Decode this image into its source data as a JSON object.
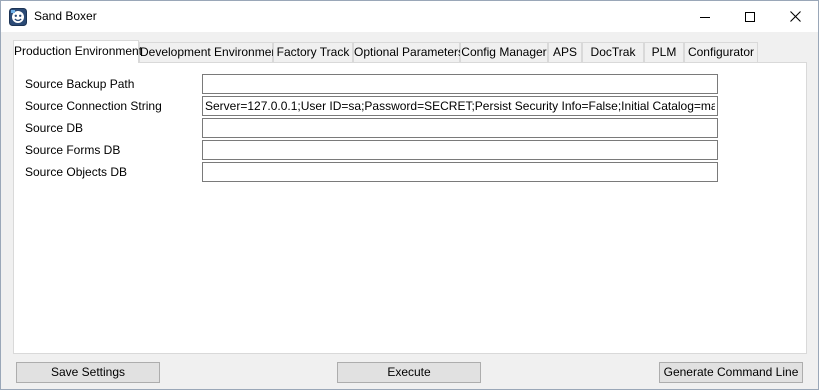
{
  "window": {
    "title": "Sand Boxer"
  },
  "caption_buttons": {
    "minimize_icon": "minimize-icon",
    "maximize_icon": "maximize-icon",
    "close_icon": "close-icon"
  },
  "tabs": [
    {
      "label": "Production Environment",
      "active": true
    },
    {
      "label": "Development Environment",
      "active": false
    },
    {
      "label": "Factory Track",
      "active": false
    },
    {
      "label": "Optional Parameters",
      "active": false
    },
    {
      "label": "Config Manager",
      "active": false
    },
    {
      "label": "APS",
      "active": false
    },
    {
      "label": "DocTrak",
      "active": false
    },
    {
      "label": "PLM",
      "active": false
    },
    {
      "label": "Configurator",
      "active": false
    }
  ],
  "fields": [
    {
      "label": "Source Backup Path",
      "value": ""
    },
    {
      "label": "Source Connection String",
      "value": "Server=127.0.0.1;User ID=sa;Password=SECRET;Persist Security Info=False;Initial Catalog=master"
    },
    {
      "label": "Source DB",
      "value": ""
    },
    {
      "label": "Source Forms DB",
      "value": ""
    },
    {
      "label": "Source Objects DB",
      "value": ""
    }
  ],
  "buttons": {
    "save": "Save Settings",
    "execute": "Execute",
    "generate": "Generate Command Line"
  },
  "colors": {
    "window_bg": "#f0f0f0",
    "panel_bg": "#ffffff",
    "button_bg": "#e1e1e1"
  }
}
